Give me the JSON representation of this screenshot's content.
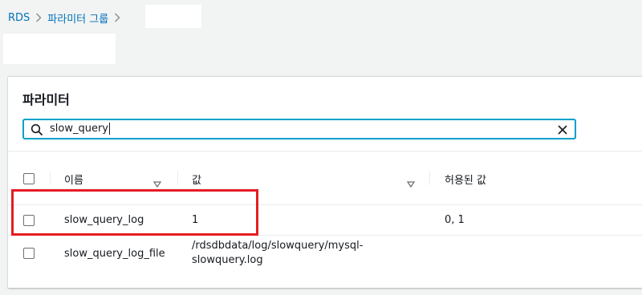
{
  "breadcrumb": {
    "items": [
      "RDS",
      "파라미터 그룹"
    ]
  },
  "panel": {
    "title": "파라미터"
  },
  "search": {
    "value": "slow_query",
    "icon": "search-icon",
    "clear_icon": "close-icon"
  },
  "table": {
    "columns": [
      "이름",
      "값",
      "허용된 값"
    ],
    "rows": [
      {
        "name": "slow_query_log",
        "value": "1",
        "allowed": "0, 1"
      },
      {
        "name": "slow_query_log_file",
        "value_lines": [
          "/rdsdbdata/log/slowquery/mysql-",
          "slowquery.log"
        ],
        "allowed": ""
      }
    ]
  },
  "colors": {
    "link": "#0073bb",
    "search_border": "#00a1c9",
    "highlight": "#e41c23"
  }
}
